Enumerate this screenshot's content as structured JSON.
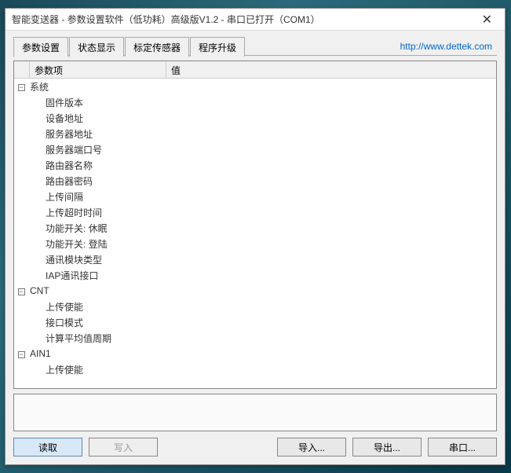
{
  "window": {
    "title": "智能变送器 - 参数设置软件（低功耗）高级版V1.2 - 串口已打开（COM1）"
  },
  "tabs": [
    "参数设置",
    "状态显示",
    "标定传感器",
    "程序升级"
  ],
  "active_tab": 0,
  "link": {
    "text": "http://www.dettek.com"
  },
  "grid": {
    "col_name": "参数项",
    "col_value": "值",
    "groups": [
      {
        "name": "系统",
        "expanded": true,
        "items": [
          {
            "name": "固件版本",
            "value": ""
          },
          {
            "name": "设备地址",
            "value": ""
          },
          {
            "name": "服务器地址",
            "value": ""
          },
          {
            "name": "服务器端口号",
            "value": ""
          },
          {
            "name": "路由器名称",
            "value": ""
          },
          {
            "name": "路由器密码",
            "value": ""
          },
          {
            "name": "上传间隔",
            "value": ""
          },
          {
            "name": "上传超时时间",
            "value": ""
          },
          {
            "name": "功能开关: 休眠",
            "value": ""
          },
          {
            "name": "功能开关: 登陆",
            "value": ""
          },
          {
            "name": "通讯模块类型",
            "value": ""
          },
          {
            "name": "IAP通讯接口",
            "value": ""
          }
        ]
      },
      {
        "name": "CNT",
        "expanded": true,
        "items": [
          {
            "name": "上传使能",
            "value": ""
          },
          {
            "name": "接口模式",
            "value": ""
          },
          {
            "name": "计算平均值周期",
            "value": ""
          }
        ]
      },
      {
        "name": "AIN1",
        "expanded": true,
        "items": [
          {
            "name": "上传使能",
            "value": ""
          }
        ]
      }
    ]
  },
  "buttons": {
    "read": "读取",
    "write": "写入",
    "import": "导入...",
    "export": "导出...",
    "serial": "串口..."
  }
}
